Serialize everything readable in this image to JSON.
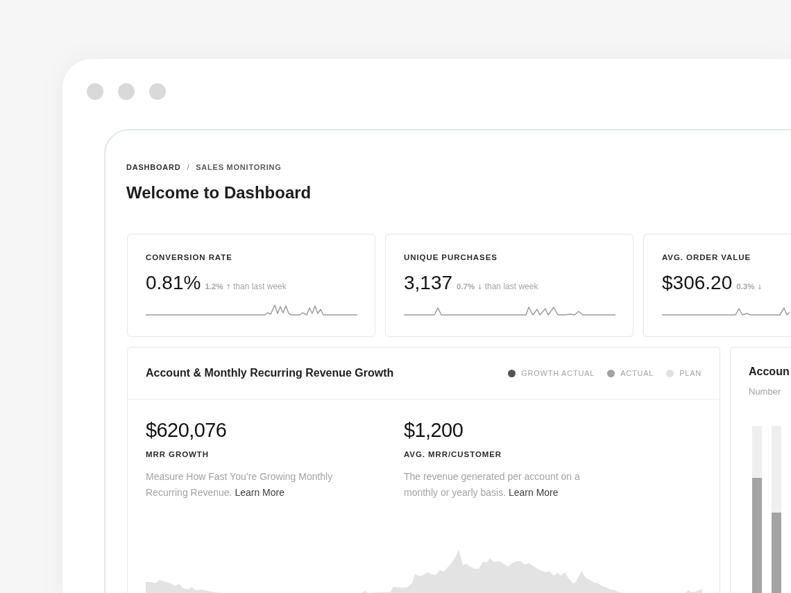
{
  "breadcrumb": {
    "items": [
      "DASHBOARD",
      "SALES MONITORING"
    ],
    "separator": "/"
  },
  "title": "Welcome to Dashboard",
  "kpis": [
    {
      "label": "CONVERSION RATE",
      "value": "0.81%",
      "change": "1.2%",
      "arrow": "↑",
      "note": "than last week"
    },
    {
      "label": "UNIQUE PURCHASES",
      "value": "3,137",
      "change": "0.7%",
      "arrow": "↓",
      "note": "than last week"
    },
    {
      "label": "AVG. ORDER VALUE",
      "value": "$306.20",
      "change": "0.3%",
      "arrow": "↓"
    }
  ],
  "revenue_panel": {
    "title": "Account & Monthly Recurring Revenue Growth",
    "legend": [
      {
        "label": "GROWTH ACTUAL",
        "color": "#555555"
      },
      {
        "label": "ACTUAL",
        "color": "#a3a3a3"
      },
      {
        "label": "PLAN",
        "color": "#e2e2e2"
      }
    ],
    "metrics": [
      {
        "value": "$620,076",
        "label": "MRR GROWTH",
        "description": "Measure How Fast You’re Growing Monthly Recurring Revenue.",
        "link": "Learn More"
      },
      {
        "value": "$1,200",
        "label": "AVG. MRR/CUSTOMER",
        "description": "The revenue generated per account on a monthly or yearly basis.",
        "link": "Learn More"
      }
    ]
  },
  "accounts_panel": {
    "title": "Accoun",
    "subtitle": "Number",
    "bars": [
      {
        "level": 0.69
      },
      {
        "level": 0.48
      }
    ]
  }
}
